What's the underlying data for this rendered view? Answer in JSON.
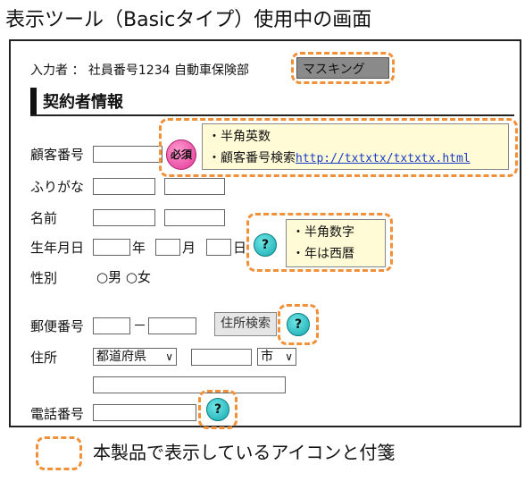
{
  "title": "表示ツール（Basicタイプ）使用中の画面",
  "header_info": {
    "inputter_label": "入力者 ： 社員番号1234 自動車保険部",
    "mask_button": "マスキング"
  },
  "section_title": "契約者情報",
  "fields": {
    "customer_no": "顧客番号",
    "furigana": "ふりがな",
    "name": "名前",
    "birthdate": "生年月日",
    "year_unit": "年",
    "month_unit": "月",
    "day_unit": "日",
    "gender": "性別",
    "gender_options": [
      "○男",
      "○女"
    ],
    "postal": "郵便番号",
    "postal_sep": "－",
    "address_search_button": "住所検索",
    "address": "住所",
    "prefecture_select": "都道府県",
    "city_select": "市",
    "phone": "電話番号"
  },
  "required_badge": "必須",
  "help_icon": "?",
  "note1": {
    "line1": "・半角英数",
    "line2_prefix": "・顧客番号検索",
    "line2_link": "http://txtxtx/txtxtx.html"
  },
  "note2": {
    "line1": "・半角数字",
    "line2": "・年は西暦"
  },
  "legend_text": "本製品で表示しているアイコンと付箋",
  "colors": {
    "dashed_highlight": "#f0913a",
    "note_bg": "#fffbd6",
    "required_badge": "#e23596",
    "help_icon": "#16aab0",
    "mask_button": "#8a8a8a"
  },
  "icons": [
    "required-badge-icon",
    "question-help-icon",
    "select-chevron-icon"
  ]
}
